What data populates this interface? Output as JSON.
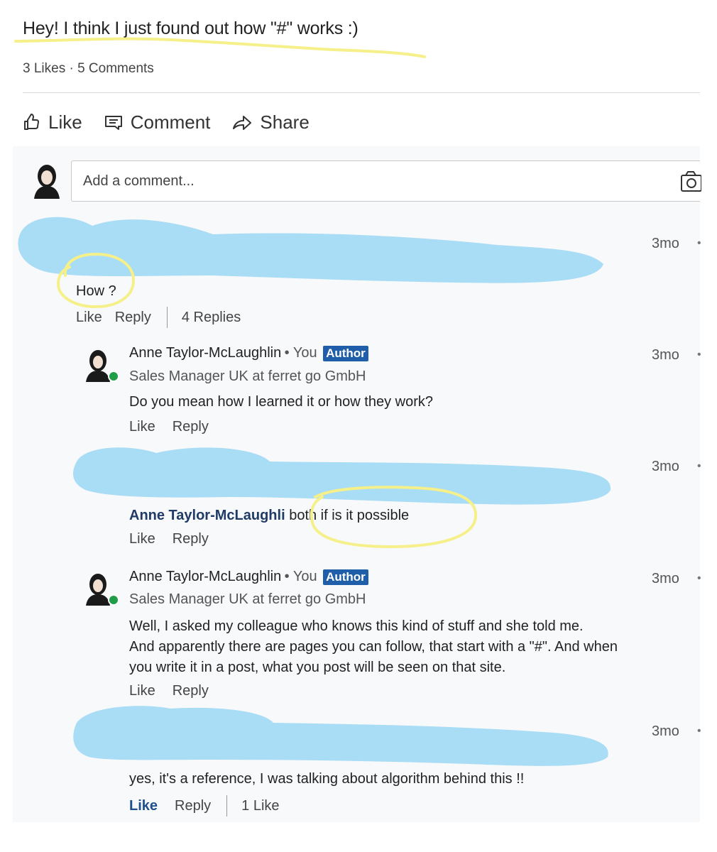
{
  "post": {
    "text": "Hey! I think I just found out how \"#\" works :)",
    "stats": "3 Likes · 5 Comments"
  },
  "actions": {
    "like": "Like",
    "comment": "Comment",
    "share": "Share"
  },
  "composer": {
    "placeholder": "Add a comment..."
  },
  "comments": [
    {
      "time": "3mo",
      "text": "How ?",
      "like": "Like",
      "reply": "Reply",
      "replies": "4 Replies"
    }
  ],
  "replies": [
    {
      "name": "Anne Taylor-McLaughlin",
      "you": "You",
      "badge": "Author",
      "headline": "Sales Manager UK at ferret go GmbH",
      "time": "3mo",
      "text": "Do you mean how I learned it or how they work?",
      "like": "Like",
      "reply": "Reply"
    },
    {
      "mention": "Anne Taylor-McLaughli",
      "time": "3mo",
      "text": "both if is it possible",
      "like": "Like",
      "reply": "Reply"
    },
    {
      "name": "Anne Taylor-McLaughlin",
      "you": "You",
      "badge": "Author",
      "headline": "Sales Manager UK at ferret go GmbH",
      "time": "3mo",
      "text_lines": [
        "Well, I asked my colleague who knows this kind of stuff and she told me.",
        "And apparently there are pages you can follow, that start with a \"#\". And when",
        "you write it in a post, what you post will be seen on that site."
      ],
      "like": "Like",
      "reply": "Reply"
    },
    {
      "time": "3mo",
      "text": "yes, it's a reference, I was talking about algorithm behind this !!",
      "like": "Like",
      "reply": "Reply",
      "likes_count": "1 Like"
    }
  ],
  "icons": {
    "like": "thumbs-up-icon",
    "comment": "comment-icon",
    "share": "share-arrow-icon",
    "camera": "camera-icon",
    "avatar": "user-avatar-icon",
    "more": "more-icon"
  },
  "colors": {
    "redaction": "#a9dcf5",
    "highlight": "#f5f08a",
    "author_badge": "#1f5ea8",
    "liked_link": "#1f4f8f",
    "online": "#1f9d48"
  }
}
